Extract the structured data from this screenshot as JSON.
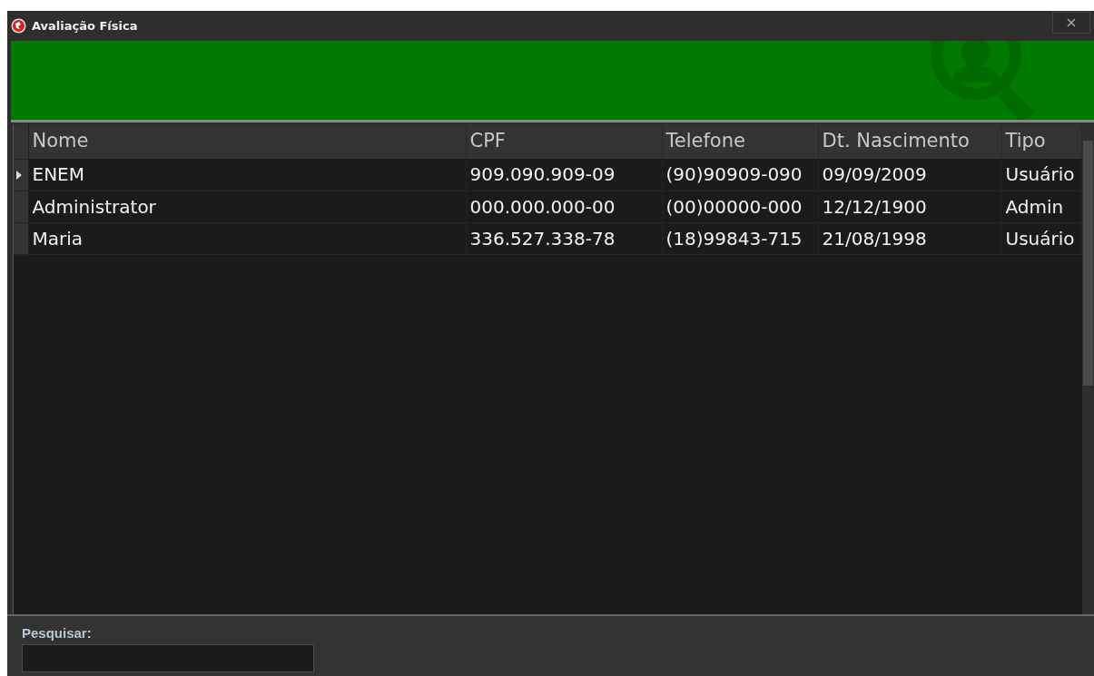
{
  "window": {
    "title": "Avaliação Física",
    "close": "×"
  },
  "table": {
    "columns": [
      "Nome",
      "CPF",
      "Telefone",
      "Dt. Nascimento",
      "Tipo"
    ],
    "rows": [
      {
        "cells": [
          "ENEM",
          "909.090.909-09",
          "(90)90909-090",
          "09/09/2009",
          "Usuário"
        ],
        "selected": true
      },
      {
        "cells": [
          "Administrator",
          "000.000.000-00",
          "(00)00000-000",
          "12/12/1900",
          "Admin"
        ],
        "selected": false
      },
      {
        "cells": [
          "Maria",
          "336.527.338-78",
          "(18)99843-715",
          "21/08/1998",
          "Usuário"
        ],
        "selected": false
      }
    ]
  },
  "search": {
    "label": "Pesquisar:"
  }
}
